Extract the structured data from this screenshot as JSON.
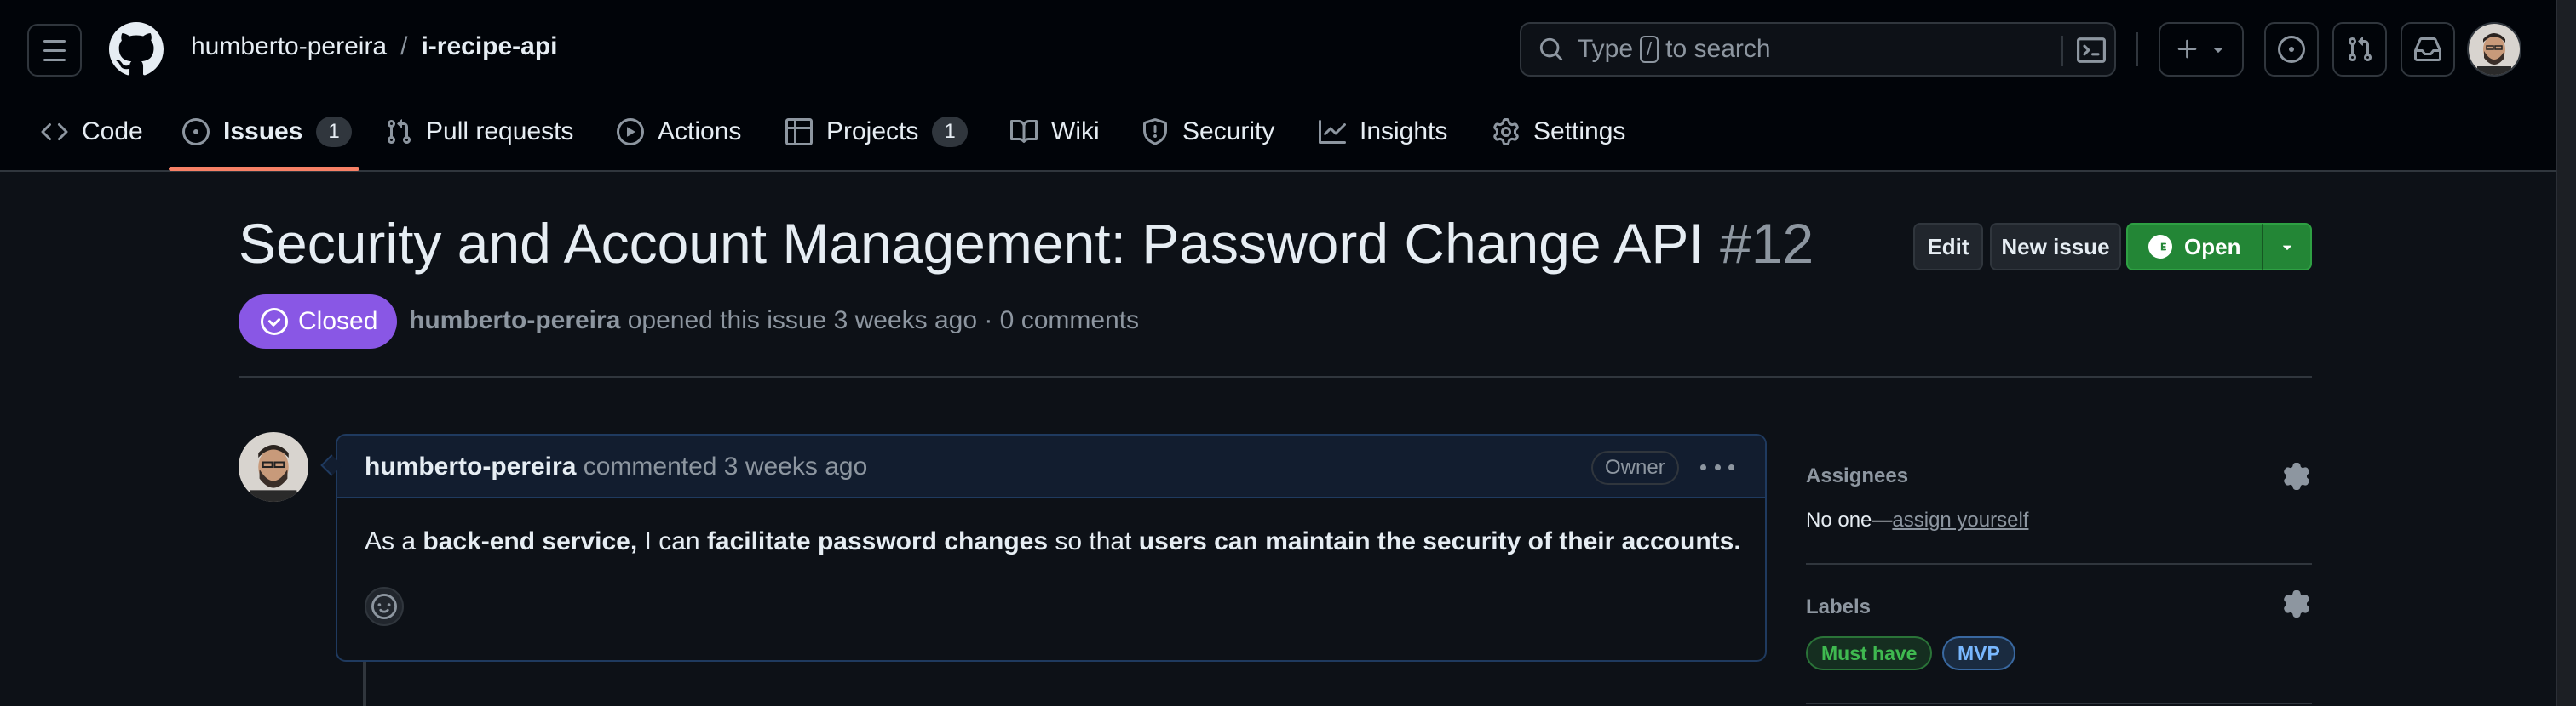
{
  "header": {
    "owner": "humberto-pereira",
    "separator": "/",
    "repo": "i-recipe-api",
    "search_prefix": "Type",
    "search_key": "/",
    "search_suffix": "to search"
  },
  "nav": {
    "code": "Code",
    "issues": "Issues",
    "issues_count": "1",
    "pull_requests": "Pull requests",
    "actions": "Actions",
    "projects": "Projects",
    "projects_count": "1",
    "wiki": "Wiki",
    "security": "Security",
    "insights": "Insights",
    "settings": "Settings"
  },
  "issue": {
    "title": "Security and Account Management: Password Change API",
    "number": "#12",
    "state": "Closed",
    "author": "humberto-pereira",
    "meta_text": "opened this issue 3 weeks ago · 0 comments"
  },
  "actions": {
    "edit": "Edit",
    "new_issue": "New issue",
    "open": "Open"
  },
  "comment": {
    "author": "humberto-pereira",
    "when": "commented 3 weeks ago",
    "role": "Owner",
    "body_1": "As a ",
    "body_2": "back-end service,",
    "body_3": " I can ",
    "body_4": "facilitate password changes",
    "body_5": " so that ",
    "body_6": "users can maintain the security of their accounts."
  },
  "sidebar": {
    "assignees_label": "Assignees",
    "assignees_none": "No one—",
    "assign_yourself": "assign yourself",
    "labels_label": "Labels",
    "labels": [
      {
        "name": "Must have",
        "color": "#3fb950"
      },
      {
        "name": "MVP",
        "color": "#58a6ff"
      }
    ]
  },
  "colors": {
    "closed": "#8957e5",
    "open_button": "#238636",
    "active_tab": "#f78166"
  }
}
